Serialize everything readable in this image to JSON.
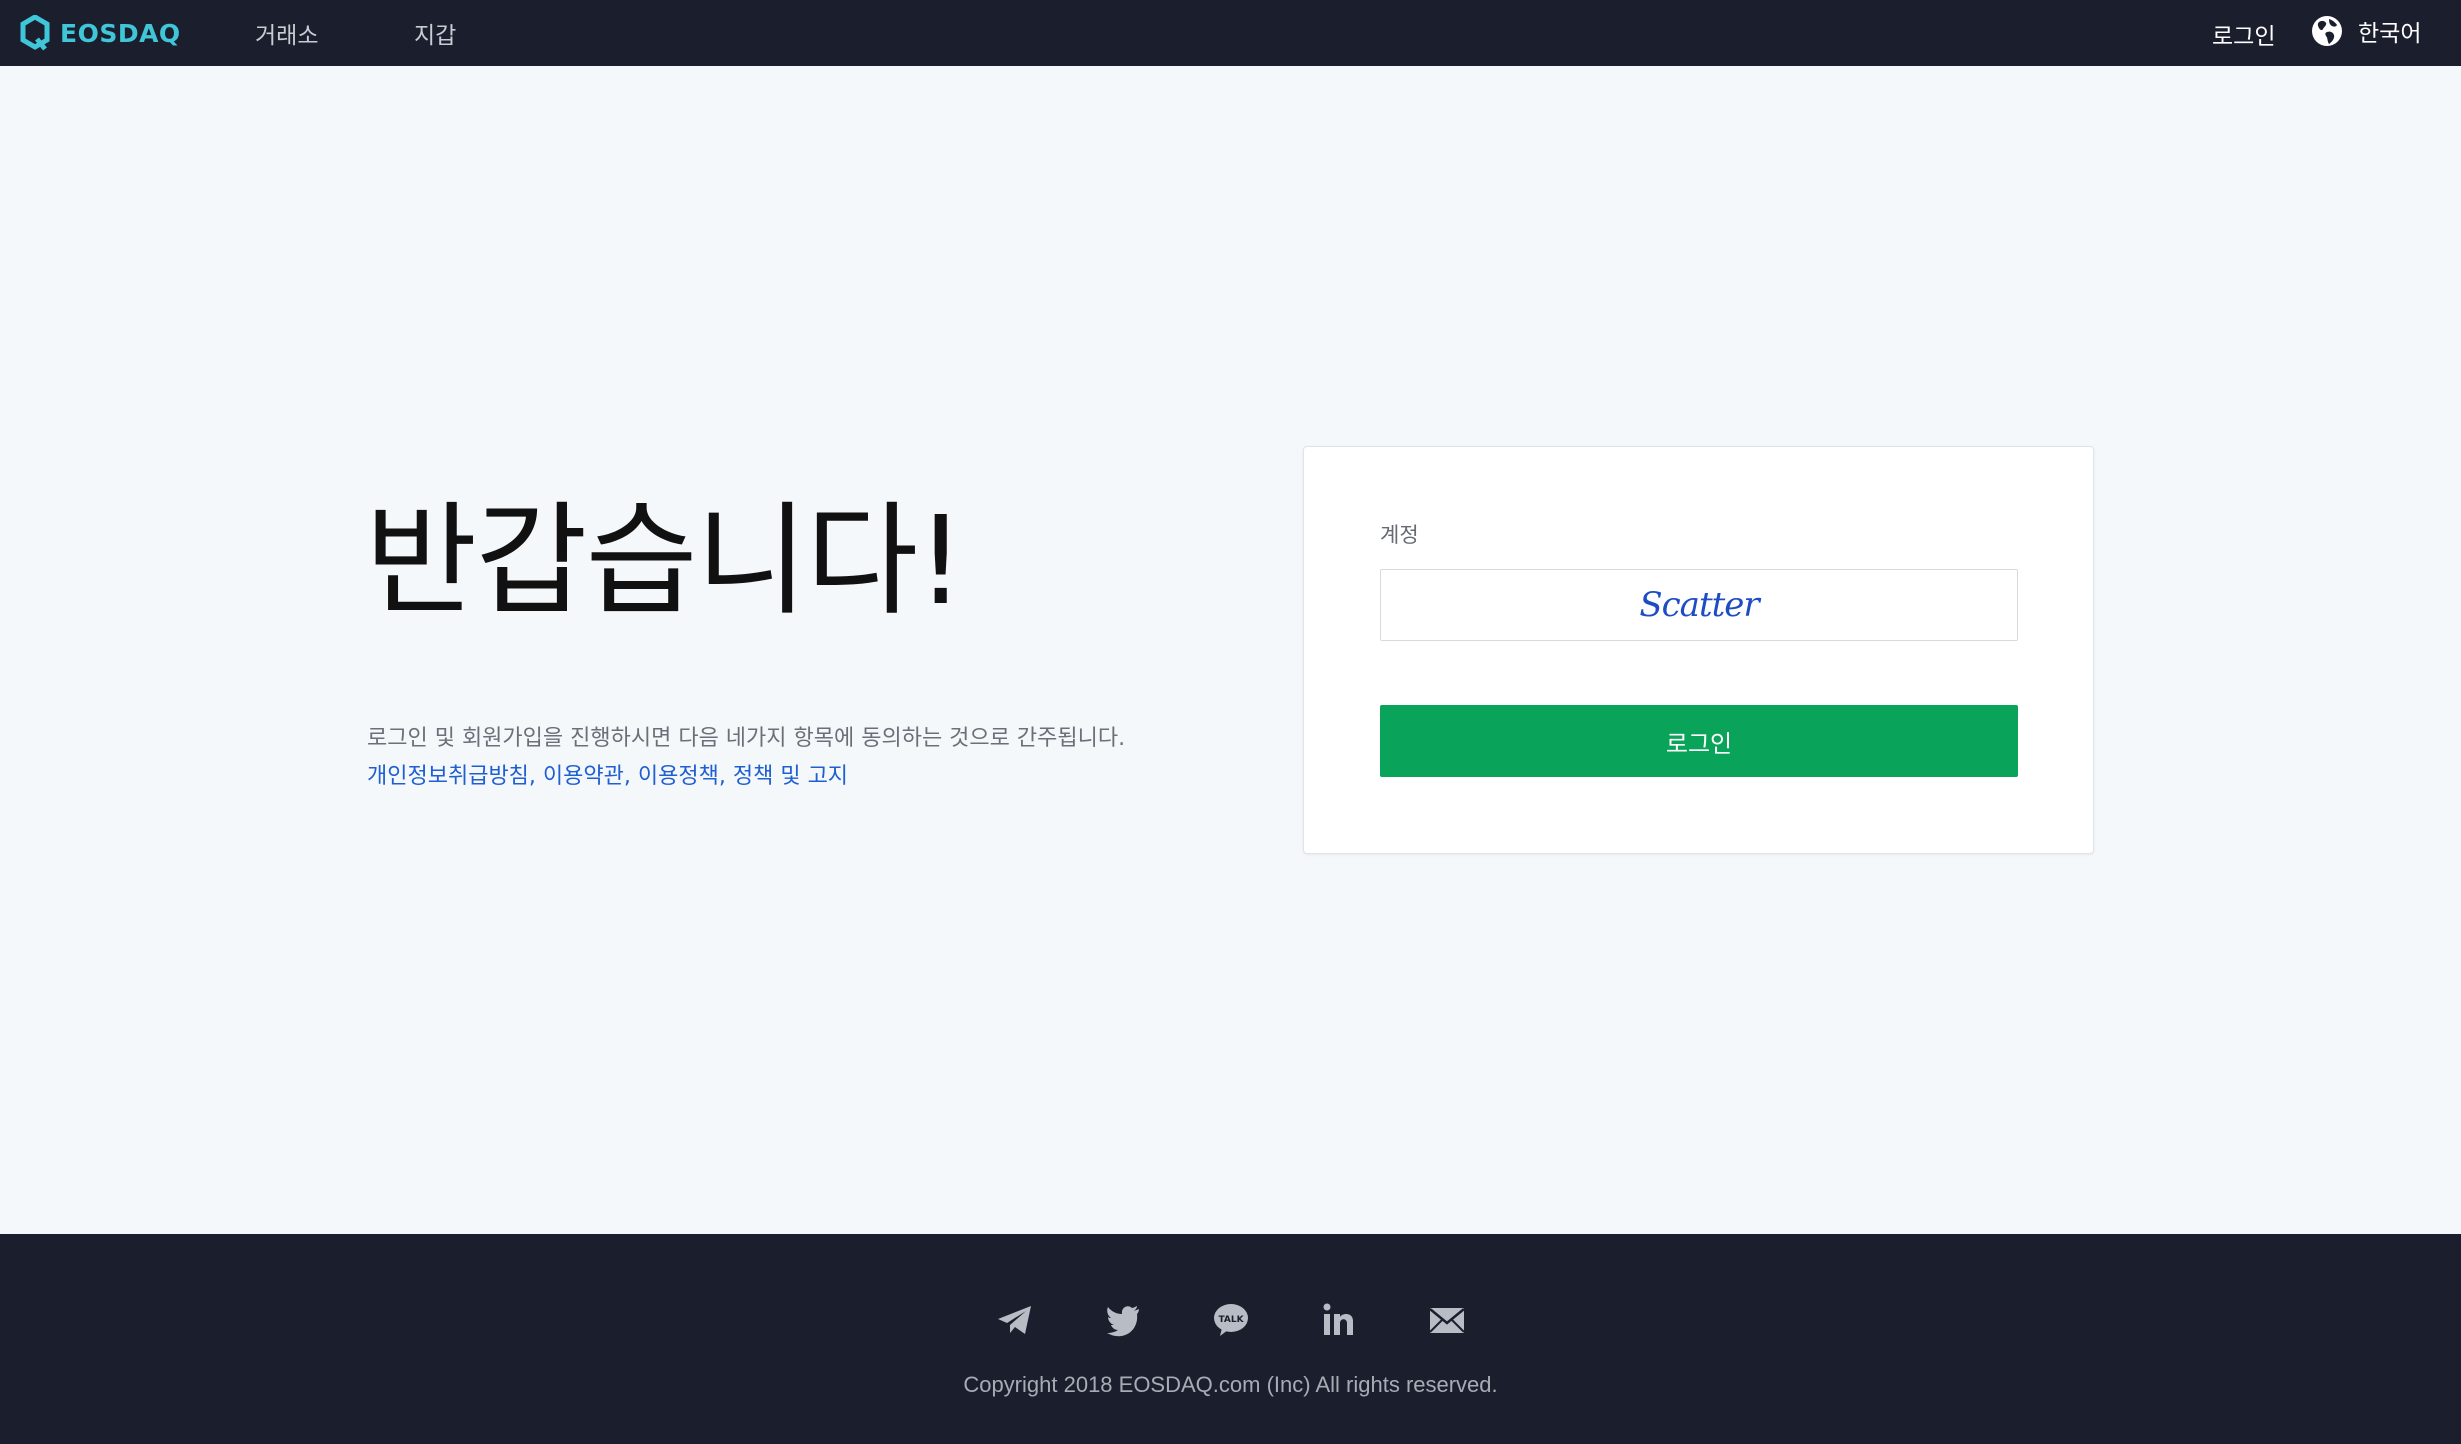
{
  "header": {
    "brand": "EOSDAQ",
    "nav": [
      {
        "label": "거래소"
      },
      {
        "label": "지갑"
      }
    ],
    "login_label": "로그인",
    "language_label": "한국어"
  },
  "main": {
    "welcome": "반갑습니다!",
    "notice": "로그인 및 회원가입을 진행하시면 다음 네가지 항목에 동의하는 것으로 간주됩니다.",
    "policies": [
      {
        "label": "개인정보취급방침"
      },
      {
        "label": "이용약관"
      },
      {
        "label": "이용정책"
      },
      {
        "label": "정책 및 고지"
      }
    ],
    "separator": ","
  },
  "login_card": {
    "account_label": "계정",
    "account_provider": "Scatter",
    "login_button": "로그인"
  },
  "footer": {
    "social": [
      "telegram-icon",
      "twitter-icon",
      "kakaotalk-icon",
      "linkedin-icon",
      "email-icon"
    ],
    "copyright": "Copyright 2018 EOSDAQ.com (Inc) All rights reserved."
  },
  "colors": {
    "header_bg": "#1b1f2d",
    "brand": "#3fc6d9",
    "accent_green": "#0aa35a",
    "link_blue": "#1f5fd1",
    "page_bg": "#f4f8fb"
  }
}
